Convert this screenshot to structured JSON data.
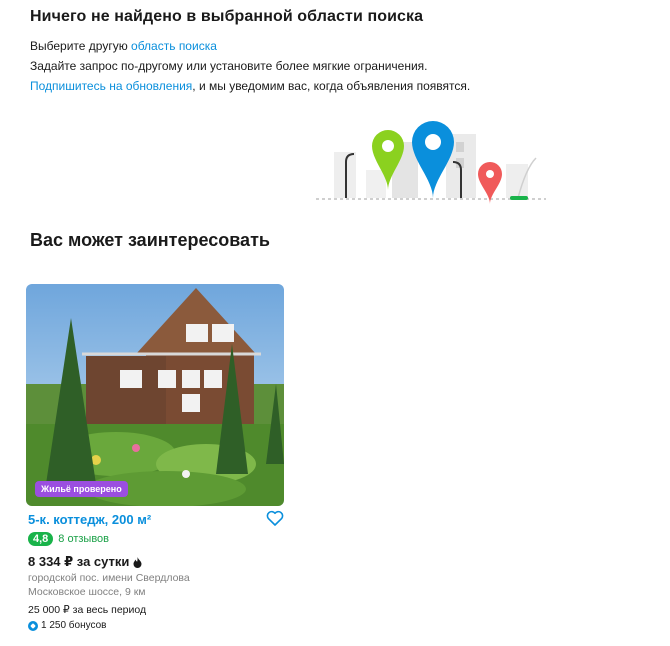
{
  "empty_state": {
    "title": "Ничего не найдено в выбранной области поиска",
    "line1_prefix": "Выберите другую ",
    "line1_link": "область поиска",
    "line2": "Задайте запрос по-другому или установите более мягкие ограничения.",
    "line3_link": "Подпишитесь на обновления",
    "line3_suffix": ", и мы уведомим вас, когда объявления появятся."
  },
  "recommendations": {
    "title": "Вас может заинтересовать",
    "cards": [
      {
        "badge": "Жильё проверено",
        "title": "5-к. коттедж, 200 м²",
        "rating": "4,8",
        "reviews": "8 отзывов",
        "price": "8 334 ₽ за сутки",
        "address_line1": "городской пос. имени Свердлова",
        "address_line2": "Московское шоссе, 9 км",
        "total": "25 000 ₽ за весь период",
        "bonus": "1 250 бонусов"
      }
    ]
  },
  "colors": {
    "link": "#0a8fdc",
    "rating": "#19b34a",
    "badge": "#9b4ee0"
  }
}
